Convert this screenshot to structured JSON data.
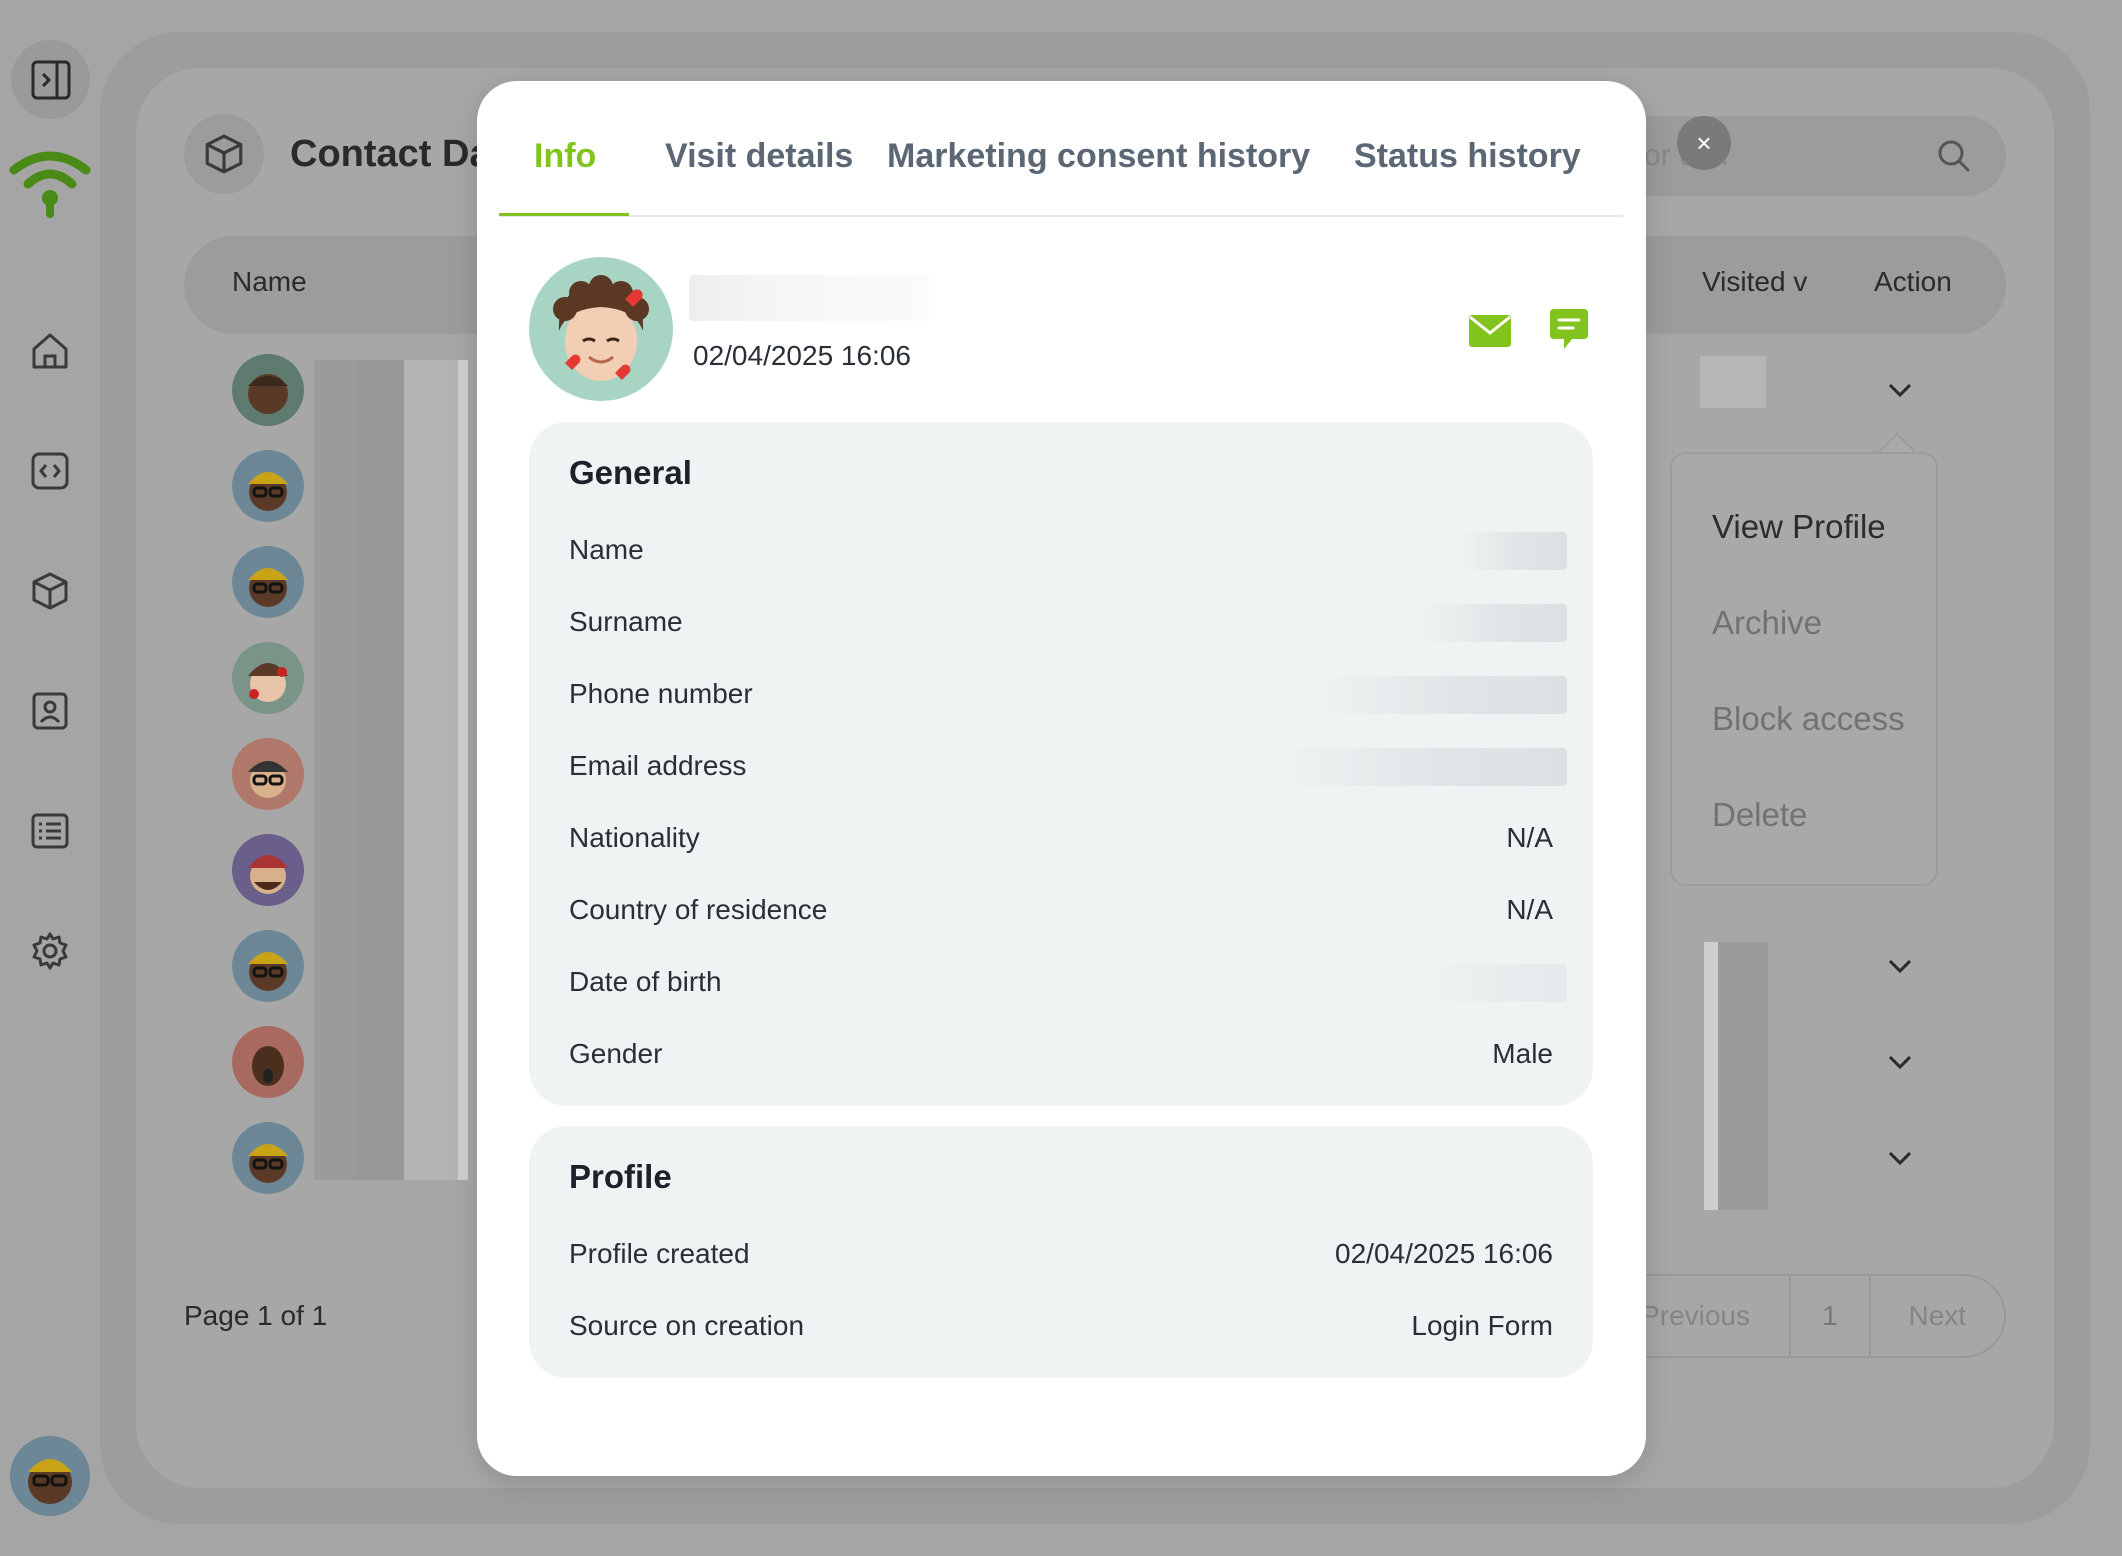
{
  "background": {
    "page_title": "Contact Da",
    "search_placeholder_visible": "or  ue..",
    "table_headers": {
      "name": "Name",
      "visited": "Visited v",
      "action": "Action"
    },
    "row_count": 9,
    "dropdown": {
      "items": [
        "View Profile",
        "Archive",
        "Block access",
        "Delete"
      ]
    },
    "pagination": {
      "page_info": "Page 1 of 1",
      "previous": "Previous",
      "current": "1",
      "next": "Next"
    }
  },
  "modal": {
    "close_symbol": "×",
    "tabs": [
      {
        "label": "Info",
        "active": true
      },
      {
        "label": "Visit details",
        "active": false
      },
      {
        "label": "Marketing consent history",
        "active": false
      },
      {
        "label": "Status history",
        "active": false
      }
    ],
    "header": {
      "timestamp": "02/04/2025 16:06",
      "icons": [
        "mail-icon",
        "chat-icon"
      ]
    },
    "general": {
      "title": "General",
      "fields": [
        {
          "label": "Name",
          "value": ""
        },
        {
          "label": "Surname",
          "value": ""
        },
        {
          "label": "Phone number",
          "value": ""
        },
        {
          "label": "Email address",
          "value": ""
        },
        {
          "label": "Nationality",
          "value": "N/A"
        },
        {
          "label": "Country of residence",
          "value": "N/A"
        },
        {
          "label": "Date of birth",
          "value": ""
        },
        {
          "label": "Gender",
          "value": "Male"
        }
      ]
    },
    "profile": {
      "title": "Profile",
      "fields": [
        {
          "label": "Profile created",
          "value": "02/04/2025 16:06"
        },
        {
          "label": "Source on creation",
          "value": "Login Form"
        }
      ]
    }
  },
  "colors": {
    "accent_green": "#82c31d",
    "tab_inactive": "#5c6775",
    "card_bg": "#f0f3f4"
  }
}
